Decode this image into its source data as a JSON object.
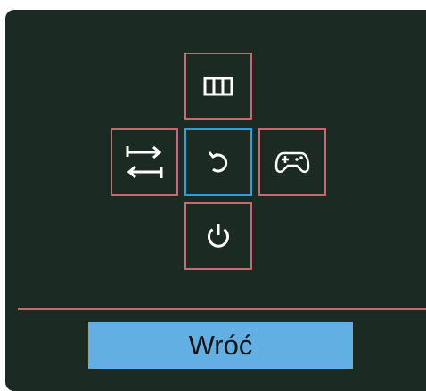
{
  "navigation_pad": {
    "top": {
      "icon": "aspect-ratio-icon"
    },
    "left": {
      "icon": "input-switch-icon"
    },
    "center": {
      "icon": "return-icon"
    },
    "right": {
      "icon": "game-mode-icon"
    },
    "bottom": {
      "icon": "power-icon"
    },
    "selected": "center"
  },
  "footer": {
    "back_label": "Wróć"
  },
  "colors": {
    "background": "#1b2a23",
    "button_border": "#c56b70",
    "selected_border": "#2e9fd8",
    "back_button": "#62b0e3",
    "icon": "#ffffff"
  }
}
